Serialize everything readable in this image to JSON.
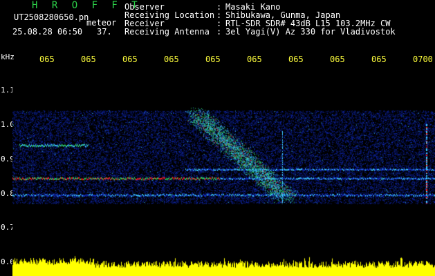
{
  "header": {
    "title": "H R O F F T",
    "filename": "UT2508280650.pn",
    "tag": "meteor",
    "datetime": "25.08.28 06:50",
    "count": "37.",
    "meta": [
      {
        "label": "Observer",
        "value": "Masaki Kano"
      },
      {
        "label": "Receiving Location",
        "value": "Shibukawa, Gunma, Japan"
      },
      {
        "label": "Receiver",
        "value": "RTL-SDR SDR# 43dB L15 103.2MHz CW"
      },
      {
        "label": "Receiving Antenna",
        "value": "3el Yagi(V) Az 330 for Vladivostok"
      }
    ],
    "colon": ":"
  },
  "axis": {
    "unit": "kHz",
    "time_labels": [
      "065",
      "065",
      "065",
      "065",
      "065",
      "065",
      "065",
      "065",
      "065",
      "0700"
    ],
    "freq_labels": [
      "1.1",
      "1.0",
      "0.9",
      "0.8",
      "0.7",
      "0.6"
    ]
  },
  "colors": {
    "background": "#000000",
    "title": "#2dd34a",
    "time_labels": "#ffff3c",
    "text": "#ffffff",
    "noise_blue": "#1430c8",
    "signal_cyan": "#3cc8ff",
    "signal_green": "#30e060",
    "signal_red": "#ff2020",
    "power_bars": "#ffff00"
  }
}
